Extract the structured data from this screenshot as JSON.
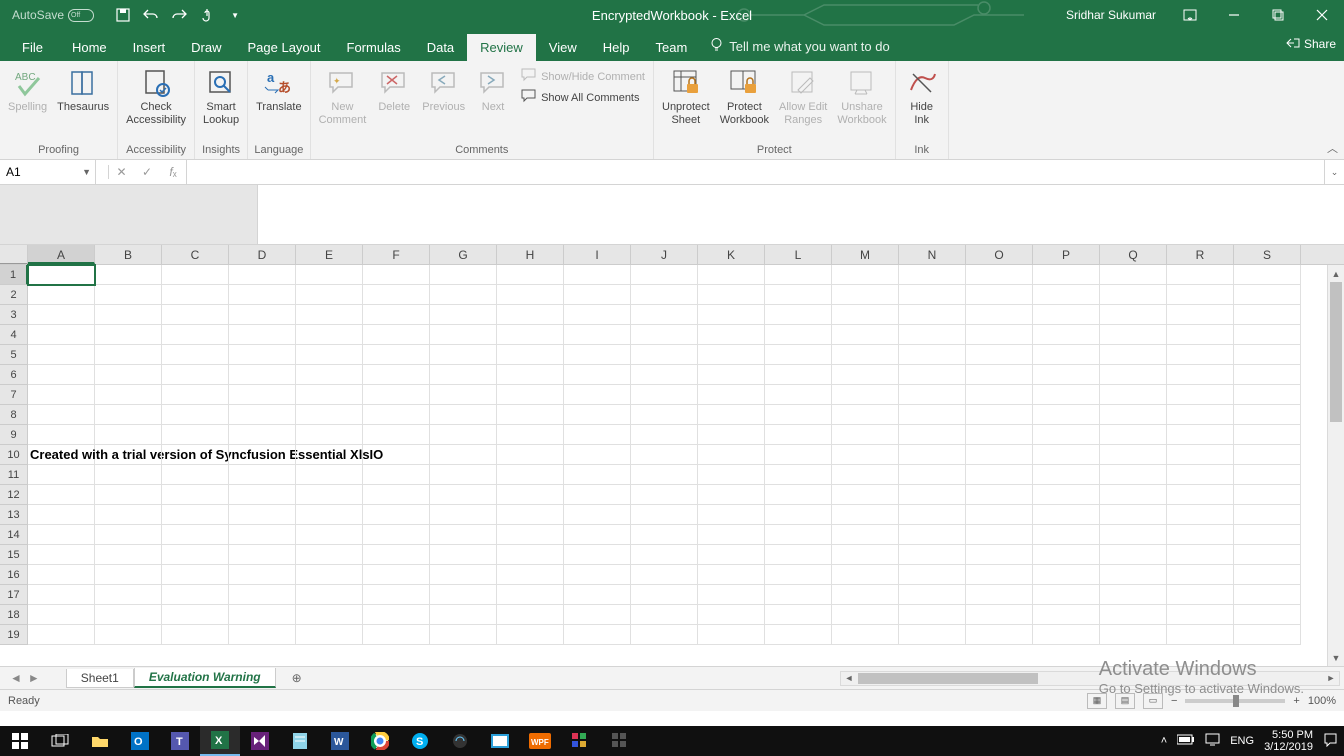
{
  "title_bar": {
    "autosave_label": "AutoSave",
    "autosave_state": "Off",
    "document_title": "EncryptedWorkbook - Excel",
    "user_name": "Sridhar Sukumar"
  },
  "ribbon_tabs": {
    "file": "File",
    "home": "Home",
    "insert": "Insert",
    "draw": "Draw",
    "page_layout": "Page Layout",
    "formulas": "Formulas",
    "data": "Data",
    "review": "Review",
    "view": "View",
    "help": "Help",
    "team": "Team",
    "tell_me": "Tell me what you want to do",
    "share": "Share"
  },
  "ribbon": {
    "proofing": {
      "spelling": "Spelling",
      "thesaurus": "Thesaurus",
      "label": "Proofing"
    },
    "accessibility": {
      "check1": "Check",
      "check2": "Accessibility",
      "label": "Accessibility"
    },
    "insights": {
      "smart1": "Smart",
      "smart2": "Lookup",
      "label": "Insights"
    },
    "language": {
      "translate": "Translate",
      "label": "Language"
    },
    "comments": {
      "new1": "New",
      "new2": "Comment",
      "delete": "Delete",
      "previous": "Previous",
      "next": "Next",
      "showhide": "Show/Hide Comment",
      "showall": "Show All Comments",
      "label": "Comments"
    },
    "protect": {
      "unprotect1": "Unprotect",
      "unprotect2": "Sheet",
      "protect1": "Protect",
      "protect2": "Workbook",
      "allow1": "Allow Edit",
      "allow2": "Ranges",
      "unshare1": "Unshare",
      "unshare2": "Workbook",
      "label": "Protect"
    },
    "ink": {
      "hide1": "Hide",
      "hide2": "Ink",
      "label": "Ink"
    }
  },
  "formula_bar": {
    "name_box": "A1",
    "formula": ""
  },
  "grid": {
    "columns": [
      "A",
      "B",
      "C",
      "D",
      "E",
      "F",
      "G",
      "H",
      "I",
      "J",
      "K",
      "L",
      "M",
      "N",
      "O",
      "P",
      "Q",
      "R",
      "S"
    ],
    "rows": [
      1,
      2,
      3,
      4,
      5,
      6,
      7,
      8,
      9,
      10,
      11,
      12,
      13,
      14,
      15,
      16,
      17,
      18,
      19
    ],
    "active_cell": "A1",
    "cell_A10": "Created with a trial version of Syncfusion Essential XlsIO"
  },
  "sheet_tabs": {
    "sheet1": "Sheet1",
    "eval_warning": "Evaluation Warning"
  },
  "status_bar": {
    "ready": "Ready",
    "zoom": "100%"
  },
  "watermark": {
    "line1": "Activate Windows",
    "line2": "Go to Settings to activate Windows."
  },
  "taskbar": {
    "lang": "ENG",
    "time": "5:50 PM",
    "date": "3/12/2019"
  }
}
